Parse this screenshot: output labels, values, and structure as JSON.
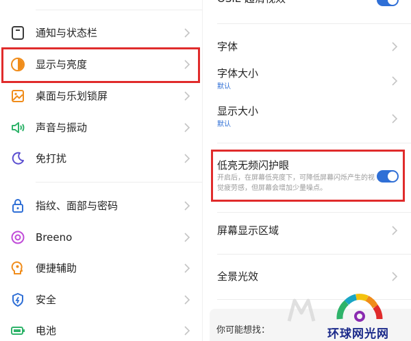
{
  "left_menu": {
    "items": [
      {
        "label": "通知与状态栏",
        "icon": "notification-bar-icon"
      },
      {
        "label": "显示与亮度",
        "icon": "display-brightness-icon"
      },
      {
        "label": "桌面与乐划锁屏",
        "icon": "desktop-lockscreen-icon"
      },
      {
        "label": "声音与振动",
        "icon": "sound-vibration-icon"
      },
      {
        "label": "免打扰",
        "icon": "moon-icon"
      },
      {
        "label": "指纹、面部与密码",
        "icon": "lock-icon"
      },
      {
        "label": "Breeno",
        "icon": "breeno-icon"
      },
      {
        "label": "便捷辅助",
        "icon": "assist-icon"
      },
      {
        "label": "安全",
        "icon": "shield-icon"
      },
      {
        "label": "电池",
        "icon": "battery-icon"
      }
    ]
  },
  "display_settings": {
    "top_item": {
      "label": "OSIE 超清视效",
      "enabled": true
    },
    "font": {
      "label": "字体"
    },
    "font_size": {
      "label": "字体大小",
      "value": "默认"
    },
    "display_size": {
      "label": "显示大小",
      "value": "默认"
    },
    "dc_dimming": {
      "label": "低亮无频闪护眼",
      "description": "开启后，在屏幕低亮度下，可降低屏幕闪烁产生的视觉疲劳感，但屏幕会增加少量噪点。",
      "enabled": true
    },
    "screen_area": {
      "label": "屏幕显示区域"
    },
    "panorama_light": {
      "label": "全景光效"
    },
    "suggestions": {
      "title": "你可能想找："
    }
  },
  "watermark": {
    "text": "环球网光网"
  },
  "colors": {
    "accent": "#2f6fd6",
    "highlight": "#e02b2b",
    "orange": "#f08c1a",
    "blue": "#2f6fd6",
    "green": "#2fb36a",
    "purple": "#5b4fd0"
  }
}
